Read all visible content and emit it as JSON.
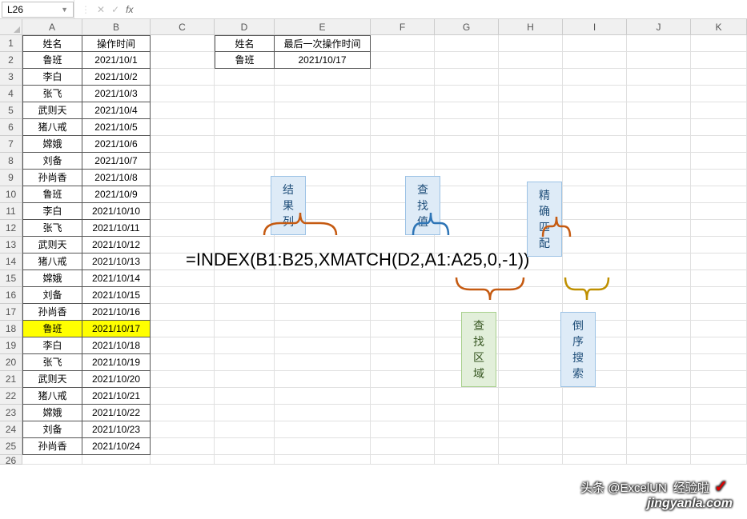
{
  "namebox": "L26",
  "formula_input": "",
  "columns": [
    "A",
    "B",
    "C",
    "D",
    "E",
    "F",
    "G",
    "H",
    "I",
    "J",
    "K"
  ],
  "header_row": {
    "A": "姓名",
    "B": "操作时间",
    "D": "姓名",
    "E": "最后一次操作时间"
  },
  "lookup_row": {
    "D": "鲁班",
    "E": "2021/10/17"
  },
  "rows": [
    {
      "n": 1,
      "A": "姓名",
      "B": "操作时间"
    },
    {
      "n": 2,
      "A": "鲁班",
      "B": "2021/10/1"
    },
    {
      "n": 3,
      "A": "李白",
      "B": "2021/10/2"
    },
    {
      "n": 4,
      "A": "张飞",
      "B": "2021/10/3"
    },
    {
      "n": 5,
      "A": "武则天",
      "B": "2021/10/4"
    },
    {
      "n": 6,
      "A": "猪八戒",
      "B": "2021/10/5"
    },
    {
      "n": 7,
      "A": "嫦娥",
      "B": "2021/10/6"
    },
    {
      "n": 8,
      "A": "刘备",
      "B": "2021/10/7"
    },
    {
      "n": 9,
      "A": "孙尚香",
      "B": "2021/10/8"
    },
    {
      "n": 10,
      "A": "鲁班",
      "B": "2021/10/9"
    },
    {
      "n": 11,
      "A": "李白",
      "B": "2021/10/10"
    },
    {
      "n": 12,
      "A": "张飞",
      "B": "2021/10/11"
    },
    {
      "n": 13,
      "A": "武则天",
      "B": "2021/10/12"
    },
    {
      "n": 14,
      "A": "猪八戒",
      "B": "2021/10/13"
    },
    {
      "n": 15,
      "A": "嫦娥",
      "B": "2021/10/14"
    },
    {
      "n": 16,
      "A": "刘备",
      "B": "2021/10/15"
    },
    {
      "n": 17,
      "A": "孙尚香",
      "B": "2021/10/16"
    },
    {
      "n": 18,
      "A": "鲁班",
      "B": "2021/10/17",
      "hl": true
    },
    {
      "n": 19,
      "A": "李白",
      "B": "2021/10/18"
    },
    {
      "n": 20,
      "A": "张飞",
      "B": "2021/10/19"
    },
    {
      "n": 21,
      "A": "武则天",
      "B": "2021/10/20"
    },
    {
      "n": 22,
      "A": "猪八戒",
      "B": "2021/10/21"
    },
    {
      "n": 23,
      "A": "嫦娥",
      "B": "2021/10/22"
    },
    {
      "n": 24,
      "A": "刘备",
      "B": "2021/10/23"
    },
    {
      "n": 25,
      "A": "孙尚香",
      "B": "2021/10/24"
    }
  ],
  "extra_row": 26,
  "annotation": {
    "formula": "=INDEX(B1:B25,XMATCH(D2,A1:A25,0,-1))",
    "tags": {
      "result_col": "结果列",
      "lookup_val": "查找值",
      "exact_match": "精确匹配",
      "lookup_range": "查找区域",
      "reverse_search": "倒序搜索"
    }
  },
  "watermark": {
    "line1": "头条 @ExcelUN",
    "line2": "jingyanla.com",
    "label": "经验啦"
  }
}
